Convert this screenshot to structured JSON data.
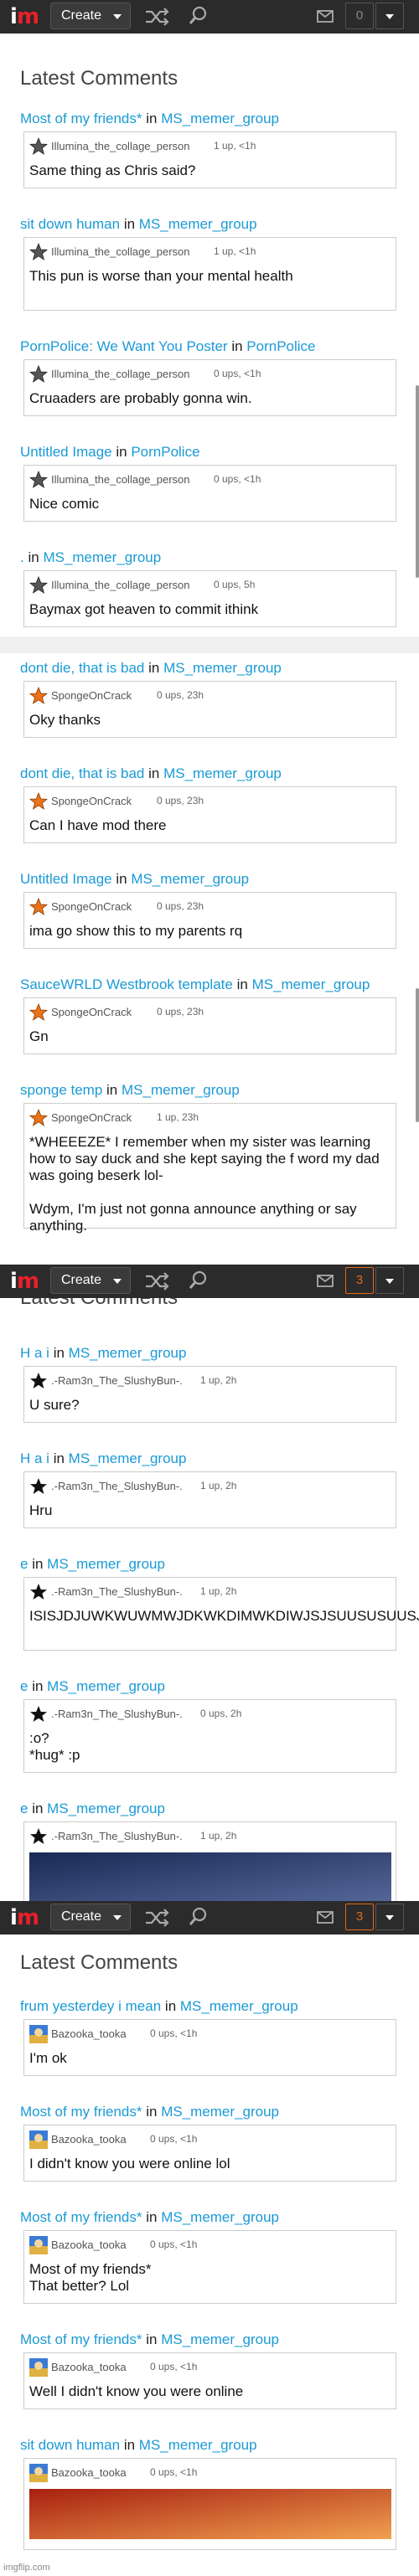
{
  "nav": {
    "create_label": "Create",
    "notif_counts": [
      "0",
      "3",
      "3"
    ]
  },
  "heading": "Latest Comments",
  "sections": [
    {
      "comments": [
        {
          "title": "Most of my friends*",
          "stream": "MS_memer_group",
          "user": "Illumina_the_collage_person",
          "points": "1 up, <1h",
          "text": "Same thing as Chris said?"
        },
        {
          "title": "sit down human",
          "stream": "MS_memer_group",
          "user": "Illumina_the_collage_person",
          "points": "1 up, <1h",
          "text": "This pun is worse than your mental health"
        },
        {
          "title": "PornPolice: We Want You Poster",
          "stream": "PornPolice",
          "user": "Illumina_the_collage_person",
          "points": "0 ups, <1h",
          "text": "Cruaaders are probably gonna win."
        },
        {
          "title": "Untitled Image",
          "stream": "PornPolice",
          "user": "Illumina_the_collage_person",
          "points": "0 ups, <1h",
          "text": "Nice comic"
        },
        {
          "title": ".",
          "stream": "MS_memer_group",
          "user": "Illumina_the_collage_person",
          "points": "0 ups, 5h",
          "text": "Baymax got heaven to commit ithink"
        }
      ]
    },
    {
      "comments": [
        {
          "title": "dont die, that is bad",
          "stream": "MS_memer_group",
          "user": "SpongeOnCrack",
          "points": "0 ups, 23h",
          "text": "Oky thanks"
        },
        {
          "title": "dont die, that is bad",
          "stream": "MS_memer_group",
          "user": "SpongeOnCrack",
          "points": "0 ups, 23h",
          "text": "Can I have mod there"
        },
        {
          "title": "Untitled Image",
          "stream": "MS_memer_group",
          "user": "SpongeOnCrack",
          "points": "0 ups, 23h",
          "text": "ima go show this to my parents rq"
        },
        {
          "title": "SauceWRLD Westbrook template",
          "stream": "MS_memer_group",
          "user": "SpongeOnCrack",
          "points": "0 ups, 23h",
          "text": "Gn"
        },
        {
          "title": "sponge temp",
          "stream": "MS_memer_group",
          "user": "SpongeOnCrack",
          "points": "1 up, 23h",
          "text": "*WHEEEZE* I remember when my sister was learning how to say duck and she kept saying the f word my dad was going beserk lol-\n\nWdym, I'm just not gonna announce anything or say anything."
        }
      ]
    },
    {
      "comments": [
        {
          "title": "H a i",
          "stream": "MS_memer_group",
          "user": ".-Ram3n_The_SlushyBun-.",
          "points": "1 up, 2h",
          "text": "U sure?"
        },
        {
          "title": "H a i",
          "stream": "MS_memer_group",
          "user": ".-Ram3n_The_SlushyBun-.",
          "points": "1 up, 2h",
          "text": "Hru"
        },
        {
          "title": "e",
          "stream": "MS_memer_group",
          "user": ".-Ram3n_The_SlushyBun-.",
          "points": "1 up, 2h",
          "text": "ISISJDJUWKWUWMWJDKWKDIMWKDIWJSJSUUSUSUUSJSIW-"
        },
        {
          "title": "e",
          "stream": "MS_memer_group",
          "user": ".-Ram3n_The_SlushyBun-.",
          "points": "0 ups, 2h",
          "text": ":o?\n*hug* :p"
        },
        {
          "title": "e",
          "stream": "MS_memer_group",
          "user": ".-Ram3n_The_SlushyBun-.",
          "points": "1 up, 2h",
          "text": ""
        }
      ]
    },
    {
      "comments": [
        {
          "title": "frum yesterdey i mean",
          "stream": "MS_memer_group",
          "user": "Bazooka_tooka",
          "points": "0 ups, <1h",
          "text": "I'm ok"
        },
        {
          "title": "Most of my friends*",
          "stream": "MS_memer_group",
          "user": "Bazooka_tooka",
          "points": "0 ups, <1h",
          "text": "I didn't know you were online lol"
        },
        {
          "title": "Most of my friends*",
          "stream": "MS_memer_group",
          "user": "Bazooka_tooka",
          "points": "0 ups, <1h",
          "text": "Most of my friends*\nThat better? Lol"
        },
        {
          "title": "Most of my friends*",
          "stream": "MS_memer_group",
          "user": "Bazooka_tooka",
          "points": "0 ups, <1h",
          "text": "Well I didn't know you were online"
        },
        {
          "title": "sit down human",
          "stream": "MS_memer_group",
          "user": "Bazooka_tooka",
          "points": "0 ups, <1h",
          "text": ""
        }
      ]
    }
  ],
  "connector": "in",
  "watermark": "imgflip.com",
  "colors": {
    "link": "#1a9ad6",
    "topbar": "#2b2b2b",
    "brand_red": "#e8202a",
    "notif_active": "#e06a1a"
  }
}
